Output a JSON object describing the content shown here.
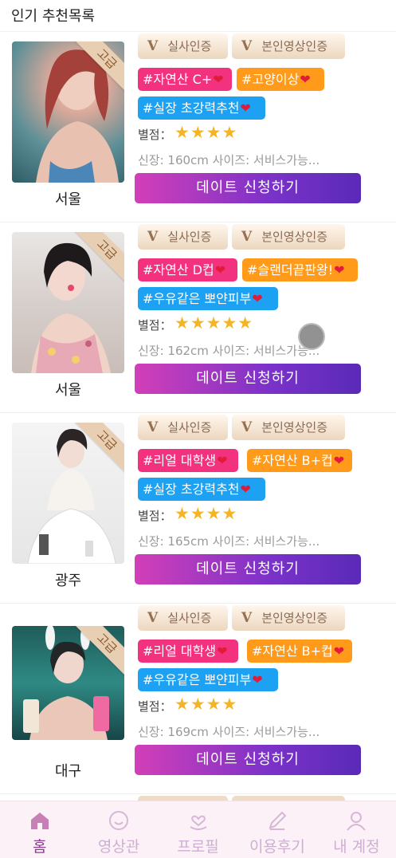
{
  "header": {
    "title": "인기 추천목록"
  },
  "cards": [
    {
      "badge": "고급",
      "region": "서울",
      "cert1": "실사인증",
      "cert2": "본인영상인증",
      "tags": [
        "#자연산 C+",
        "#고양이상",
        "#실장 초강력추천"
      ],
      "rating_label": "별점：",
      "stars": "★★★★",
      "rating_value": 4,
      "info": "신장: 160cm 사이즈:  서비스가능...",
      "button": "데이트 신청하기"
    },
    {
      "badge": "고급",
      "region": "서울",
      "cert1": "실사인증",
      "cert2": "본인영상인증",
      "tags": [
        "#자연산 D컵",
        "#슬랜더끝판왕!",
        "#우유같은 뽀얀피부"
      ],
      "rating_label": "별점：",
      "stars": "★★★★★",
      "rating_value": 5,
      "info": "신장: 162cm 사이즈:  서비스가능...",
      "button": "데이트 신청하기"
    },
    {
      "badge": "고급",
      "region": "광주",
      "cert1": "실사인증",
      "cert2": "본인영상인증",
      "tags": [
        "#리얼 대학생",
        "#자연산 B+컵",
        "#실장 초강력추천"
      ],
      "rating_label": "별점：",
      "stars": "★★★★",
      "rating_value": 4,
      "info": "신장: 165cm 사이즈:  서비스가능...",
      "button": "데이트 신청하기"
    },
    {
      "badge": "고급",
      "region": "대구",
      "cert1": "실사인증",
      "cert2": "본인영상인증",
      "tags": [
        "#리얼 대학생",
        "#자연산 B+컵",
        "#우유같은 뽀얀피부"
      ],
      "rating_label": "별점：",
      "stars": "★★★★",
      "rating_value": 4,
      "info": "신장: 169cm 사이즈:  서비스가능...",
      "button": "데이트 신청하기"
    }
  ],
  "nav": {
    "items": [
      {
        "label": "홈",
        "icon": "home-icon",
        "active": true
      },
      {
        "label": "영상관",
        "icon": "smile-icon",
        "active": false
      },
      {
        "label": "프로필",
        "icon": "heart-hand-icon",
        "active": false
      },
      {
        "label": "이용후기",
        "icon": "pencil-icon",
        "active": false
      },
      {
        "label": "내 계정",
        "icon": "user-icon",
        "active": false
      }
    ]
  },
  "colors": {
    "accent": "#8a3f8f",
    "button_gradient_start": "#d33fb8",
    "button_gradient_end": "#5a2ab7",
    "tag_pink": "#f2327f",
    "tag_orange": "#ff9a1a",
    "tag_blue": "#1da1f2",
    "star": "#f5b523"
  }
}
